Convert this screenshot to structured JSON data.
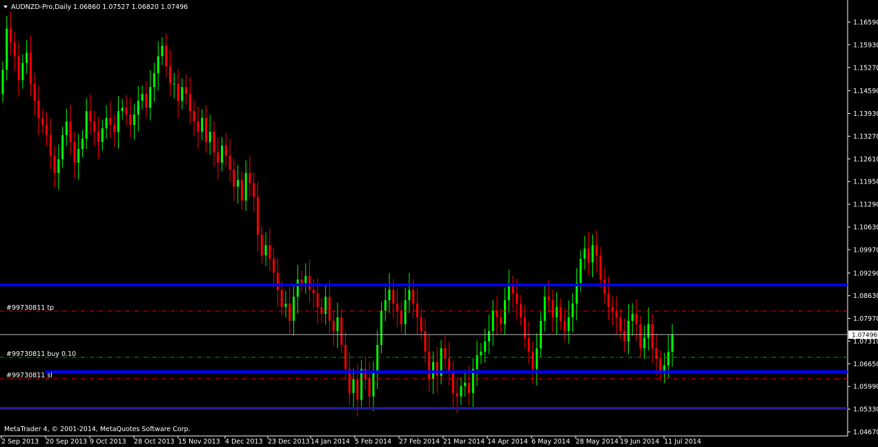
{
  "window": {
    "title": "AUDNZD-Pro,Daily",
    "ohlc": "1.06860 1.07527 1.06820 1.07496",
    "copyright": "MetaTrader 4, © 2001-2014, MetaQuotes Software Corp."
  },
  "colors": {
    "background": "#000000",
    "bull": "#00ff00",
    "bear": "#ff0000",
    "axis": "#ffffff",
    "hline": "#0000ff",
    "hline_dark": "#1b1b8f",
    "tp_sl": "#ff0000",
    "buy": "#00aa00",
    "bid_line": "#c0c0c0"
  },
  "orders": {
    "tp_label": "#99730811 tp",
    "buy_label": "#99730811 buy 0.10",
    "sl_label": "#99730811 sl"
  },
  "chart_data": {
    "type": "candlestick",
    "symbol": "AUDNZD-Pro",
    "timeframe": "Daily",
    "ylim": [
      1.0467,
      1.172
    ],
    "y_ticks": [
      "1.16590",
      "1.15930",
      "1.15270",
      "1.14590",
      "1.13930",
      "1.13270",
      "1.12610",
      "1.11950",
      "1.11290",
      "1.10630",
      "1.09970",
      "1.09290",
      "1.08630",
      "1.07970",
      "1.07310",
      "1.06650",
      "1.05990",
      "1.05330",
      "1.04670"
    ],
    "x_ticks": [
      "2 Sep 2013",
      "20 Sep 2013",
      "9 Oct 2013",
      "28 Oct 2013",
      "15 Nov 2013",
      "4 Dec 2013",
      "23 Dec 2013",
      "14 Jan 2014",
      "5 Feb 2014",
      "27 Feb 2014",
      "21 Mar 2014",
      "14 Apr 2014",
      "6 May 2014",
      "28 May 2014",
      "19 Jun 2014",
      "11 Jul 2014"
    ],
    "close_series": [
      1.152,
      1.164,
      1.16,
      1.156,
      1.149,
      1.154,
      1.157,
      1.148,
      1.143,
      1.138,
      1.136,
      1.133,
      1.127,
      1.122,
      1.126,
      1.133,
      1.137,
      1.131,
      1.125,
      1.129,
      1.132,
      1.14,
      1.137,
      1.134,
      1.131,
      1.135,
      1.138,
      1.136,
      1.134,
      1.14,
      1.141,
      1.139,
      1.136,
      1.139,
      1.143,
      1.145,
      1.141,
      1.147,
      1.151,
      1.156,
      1.159,
      1.153,
      1.148,
      1.148,
      1.143,
      1.147,
      1.145,
      1.14,
      1.137,
      1.134,
      1.138,
      1.131,
      1.134,
      1.128,
      1.125,
      1.13,
      1.127,
      1.123,
      1.118,
      1.12,
      1.114,
      1.122,
      1.119,
      1.115,
      1.104,
      1.098,
      1.101,
      1.097,
      1.093,
      1.088,
      1.083,
      1.084,
      1.079,
      1.086,
      1.091,
      1.09,
      1.092,
      1.088,
      1.087,
      1.083,
      1.081,
      1.086,
      1.079,
      1.076,
      1.08,
      1.072,
      1.065,
      1.058,
      1.062,
      1.056,
      1.065,
      1.062,
      1.057,
      1.064,
      1.072,
      1.082,
      1.085,
      1.088,
      1.084,
      1.082,
      1.078,
      1.085,
      1.088,
      1.084,
      1.08,
      1.076,
      1.07,
      1.062,
      1.067,
      1.063,
      1.071,
      1.068,
      1.064,
      1.058,
      1.057,
      1.06,
      1.061,
      1.058,
      1.065,
      1.069,
      1.07,
      1.073,
      1.076,
      1.082,
      1.08,
      1.078,
      1.085,
      1.089,
      1.087,
      1.084,
      1.08,
      1.074,
      1.07,
      1.065,
      1.071,
      1.079,
      1.086,
      1.085,
      1.08,
      1.083,
      1.079,
      1.076,
      1.08,
      1.084,
      1.09,
      1.097,
      1.1,
      1.096,
      1.101,
      1.098,
      1.091,
      1.087,
      1.083,
      1.082,
      1.08,
      1.076,
      1.073,
      1.079,
      1.081,
      1.078,
      1.071,
      1.074,
      1.078,
      1.071,
      1.068,
      1.064,
      1.066,
      1.07,
      1.07496
    ]
  }
}
